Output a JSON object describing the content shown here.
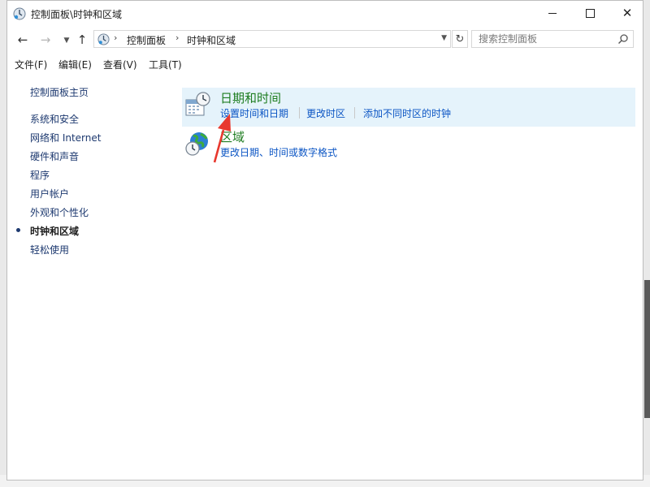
{
  "window": {
    "title": "控制面板\\时钟和区域",
    "controls": {
      "minimize": "minimize",
      "maximize": "maximize",
      "close": "close"
    }
  },
  "address": {
    "breadcrumbs": [
      "控制面板",
      "时钟和区域"
    ],
    "search_placeholder": "搜索控制面板"
  },
  "menu": {
    "items": [
      "文件(F)",
      "编辑(E)",
      "查看(V)",
      "工具(T)"
    ]
  },
  "sidebar": {
    "home": "控制面板主页",
    "items": [
      "系统和安全",
      "网络和 Internet",
      "硬件和声音",
      "程序",
      "用户帐户",
      "外观和个性化",
      "时钟和区域",
      "轻松使用"
    ],
    "current": "时钟和区域"
  },
  "categories": [
    {
      "title": "日期和时间",
      "icon": "calendar-clock-icon",
      "links": [
        "设置时间和日期",
        "更改时区",
        "添加不同时区的时钟"
      ]
    },
    {
      "title": "区域",
      "icon": "globe-clock-icon",
      "links": [
        "更改日期、时间或数字格式"
      ]
    }
  ],
  "annotation": {
    "arrow_color": "#e8382e"
  },
  "colors": {
    "link": "#0b55c4",
    "category_title": "#1e7d20",
    "hover_bg": "#e5f3fb",
    "nav_link": "#1e3a70"
  }
}
